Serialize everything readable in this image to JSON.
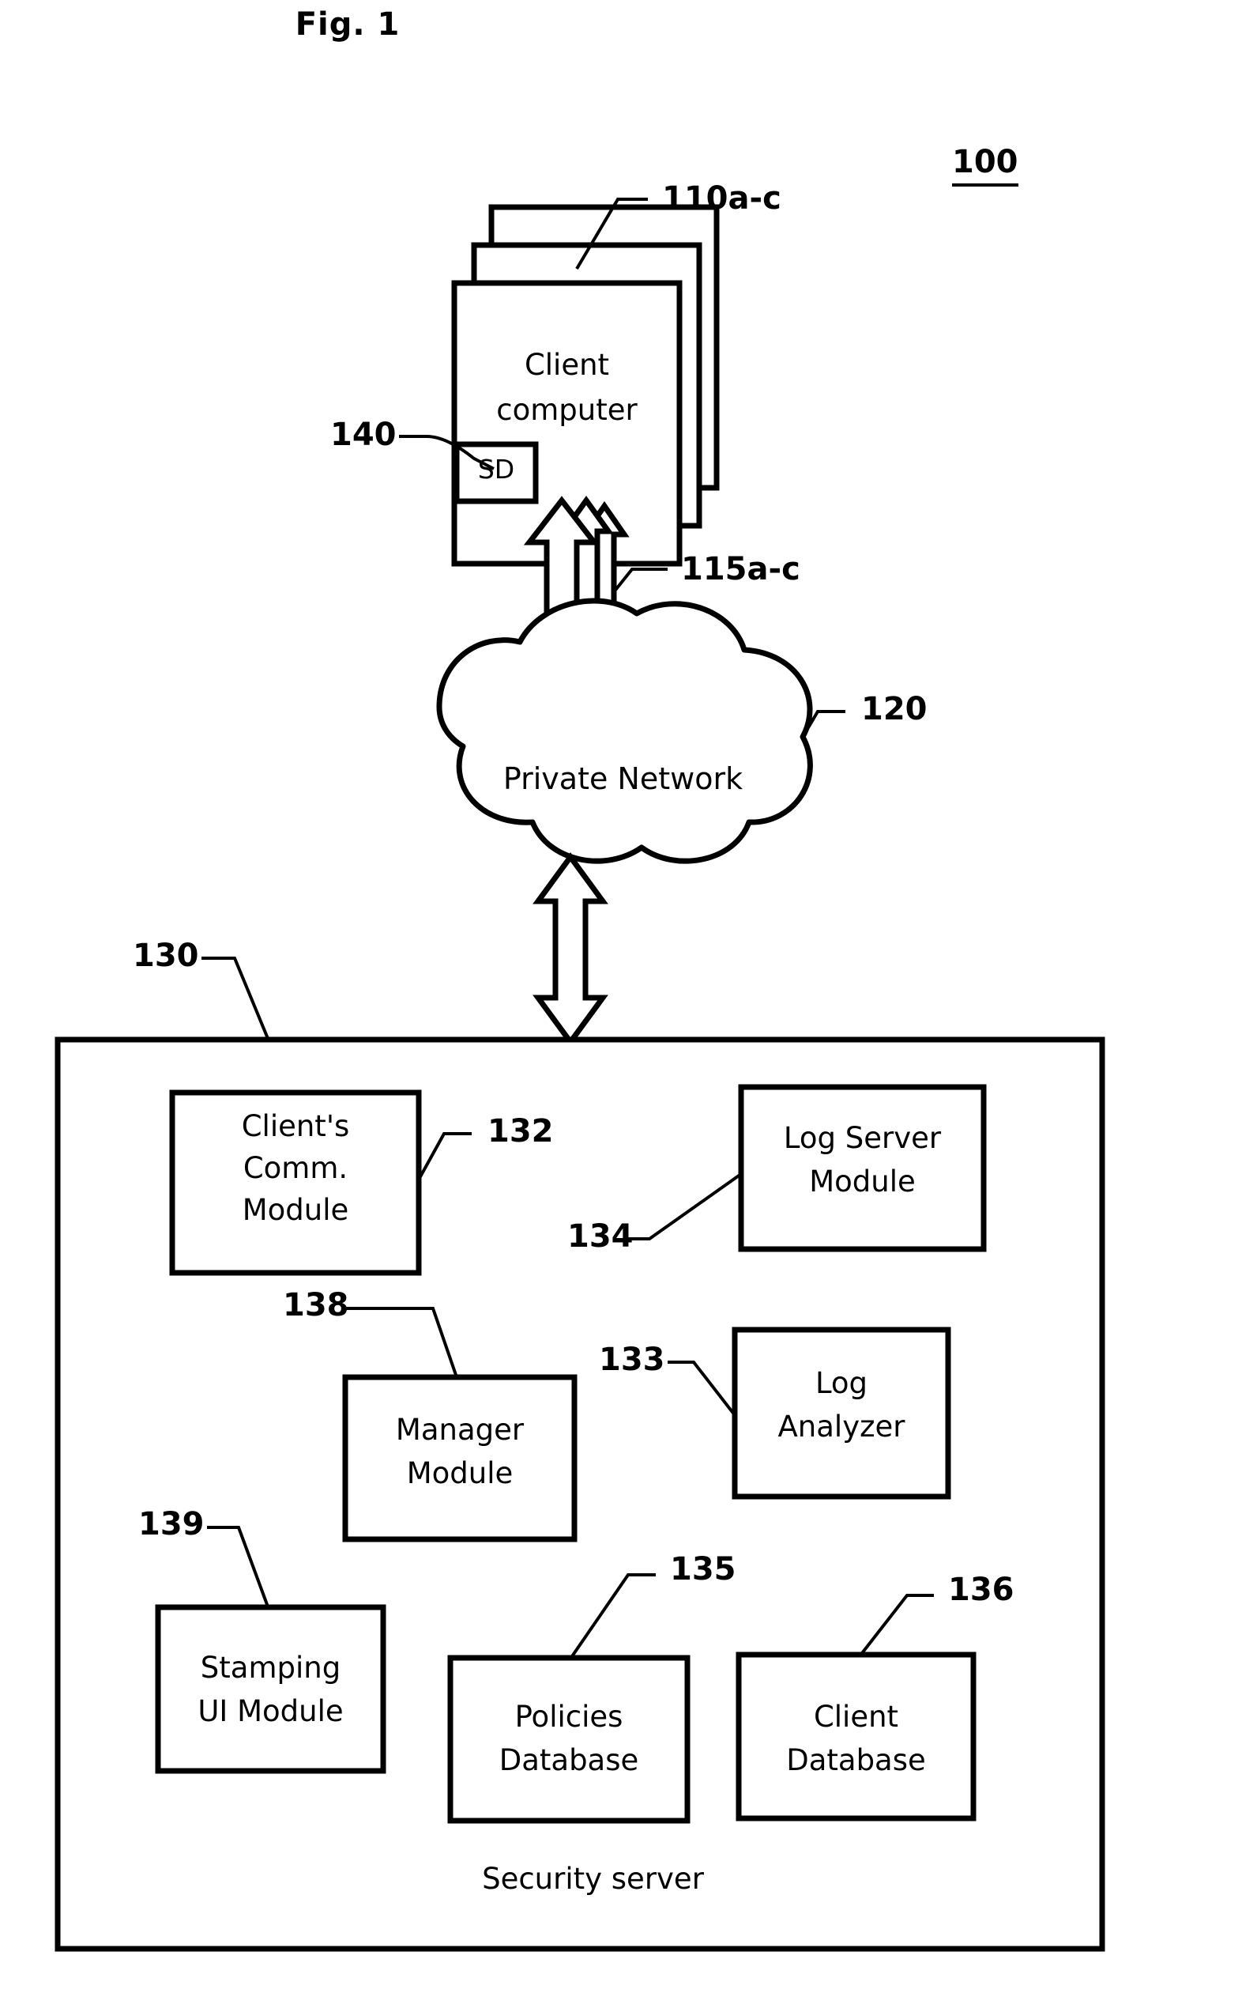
{
  "figure": {
    "title": "Fig. 1",
    "system_ref": "100",
    "bottom_caption": "Security server"
  },
  "nodes": {
    "client_stack": {
      "label_line1": "Client",
      "label_line2": "computer",
      "ref": "110a-c",
      "badge": {
        "label": "SD",
        "ref": "140"
      }
    },
    "network": {
      "label": "Private Network",
      "ref": "120"
    },
    "links": {
      "client_to_network_ref": "115a-c",
      "network_to_server_ref": ""
    },
    "server": {
      "ref": "130",
      "caption": "Security server",
      "modules": [
        {
          "id": "clients-comm-module",
          "lines": [
            "Client's",
            "Comm.",
            "Module"
          ],
          "ref": "132"
        },
        {
          "id": "log-server-module",
          "lines": [
            "Log Server",
            "Module"
          ],
          "ref": "134"
        },
        {
          "id": "manager-module",
          "lines": [
            "Manager",
            "Module"
          ],
          "ref": "138"
        },
        {
          "id": "log-analyzer",
          "lines": [
            "Log",
            "Analyzer"
          ],
          "ref": "133"
        },
        {
          "id": "stamping-ui-module",
          "lines": [
            "Stamping",
            "UI Module"
          ],
          "ref": "139"
        },
        {
          "id": "policies-database",
          "lines": [
            "Policies",
            "Database"
          ],
          "ref": "135"
        },
        {
          "id": "client-database",
          "lines": [
            "Client",
            "Database"
          ],
          "ref": "136"
        }
      ]
    }
  },
  "colors": {
    "ink": "#000000",
    "paper": "#ffffff"
  }
}
